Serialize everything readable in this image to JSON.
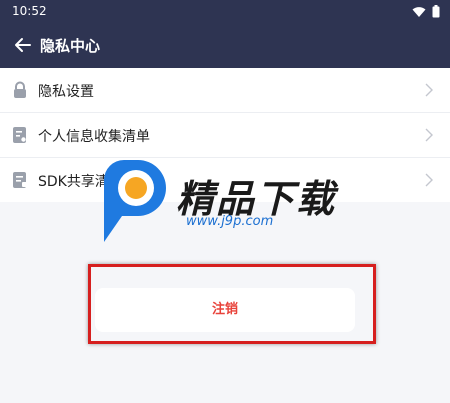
{
  "status_bar": {
    "time": "10:52"
  },
  "app_bar": {
    "title": "隐私中心"
  },
  "menu": {
    "items": [
      {
        "label": "隐私设置",
        "icon": "lock-icon"
      },
      {
        "label": "个人信息收集清单",
        "icon": "document-icon"
      },
      {
        "label": "SDK共享清单",
        "icon": "list-icon"
      }
    ]
  },
  "watermark": {
    "text": "精品下载",
    "url": "www.j9p.com"
  },
  "actions": {
    "cancel_label": "注销"
  },
  "colors": {
    "app_bar": "#2e3452",
    "cancel_text": "#e8433b",
    "highlight": "#d61f1f"
  }
}
